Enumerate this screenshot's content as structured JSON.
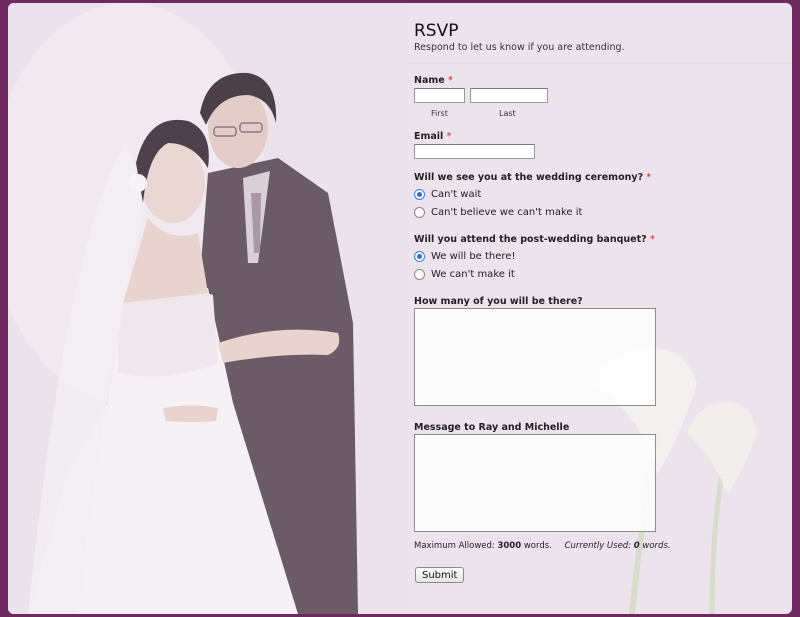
{
  "form": {
    "title": "RSVP",
    "subtitle": "Respond to let us know if you are attending.",
    "name": {
      "label": "Name",
      "required_mark": "*",
      "first_label": "First",
      "last_label": "Last",
      "first_value": "",
      "last_value": ""
    },
    "email": {
      "label": "Email",
      "required_mark": "*",
      "value": ""
    },
    "ceremony": {
      "label": "Will we see you at the wedding ceremony?",
      "required_mark": "*",
      "options": [
        "Can't wait",
        "Can't believe we can't make it"
      ],
      "selected_index": 0
    },
    "banquet": {
      "label": "Will you attend the post-wedding banquet?",
      "required_mark": "*",
      "options": [
        "We will be there!",
        "We can't make it"
      ],
      "selected_index": 0
    },
    "guests": {
      "label": "How many of you will be there?",
      "value": ""
    },
    "message": {
      "label": "Message to Ray and Michelle",
      "value": ""
    },
    "counter": {
      "max_prefix": "Maximum Allowed:",
      "max_value": "3000",
      "max_suffix": "words.",
      "used_prefix": "Currently Used:",
      "used_value": "0",
      "used_suffix": "words."
    },
    "submit_label": "Submit"
  },
  "colors": {
    "frame": "#6e2a60",
    "background": "#ece3ec",
    "accent": "#2f6fd6",
    "required": "#d21f1f"
  },
  "icons": {
    "photo": "wedding-couple-photo",
    "decoration": "calla-lily-decoration"
  }
}
